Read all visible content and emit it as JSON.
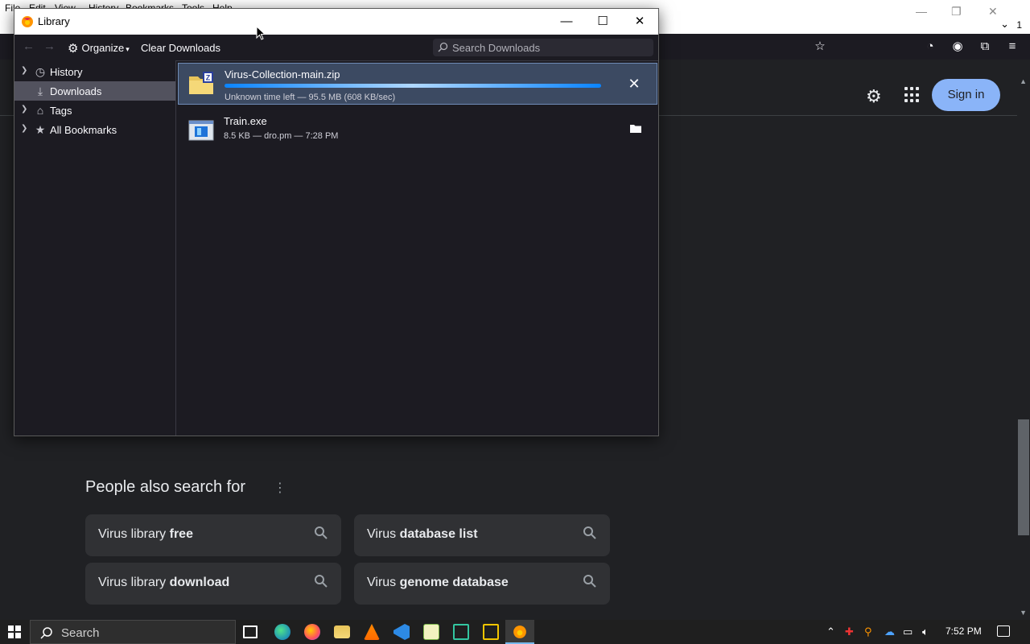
{
  "browser": {
    "menu": [
      "File",
      "Edit",
      "View",
      "History",
      "Bookmarks",
      "Tools",
      "Help"
    ],
    "tab_count": "1",
    "signin_label": "Sign in",
    "people_also_search": {
      "title": "People also search for",
      "chips": [
        {
          "prefix": "Virus library ",
          "bold": "free"
        },
        {
          "prefix": "Virus ",
          "bold": "database list"
        },
        {
          "prefix": "Virus library ",
          "bold": "download"
        },
        {
          "prefix": "Virus ",
          "bold": "genome database"
        }
      ]
    }
  },
  "library": {
    "title": "Library",
    "organize_label": "Organize",
    "clear_label": "Clear Downloads",
    "search_placeholder": "Search Downloads",
    "sidebar": [
      {
        "label": "History",
        "icon": "clock-icon",
        "expandable": true,
        "selected": false
      },
      {
        "label": "Downloads",
        "icon": "download-icon",
        "expandable": false,
        "selected": true
      },
      {
        "label": "Tags",
        "icon": "tag-icon",
        "expandable": true,
        "selected": false
      },
      {
        "label": "All Bookmarks",
        "icon": "star-icon",
        "expandable": true,
        "selected": false
      }
    ],
    "downloads": [
      {
        "name": "Virus-Collection-main.zip",
        "status": "Unknown time left — 95.5 MB (608 KB/sec)",
        "progress": 1.0,
        "in_progress": true,
        "icon": "zip-folder-icon",
        "action": "cancel"
      },
      {
        "name": "Train.exe",
        "status": "8.5 KB — dro.pm — 7:28 PM",
        "in_progress": false,
        "icon": "exe-icon",
        "action": "open-folder"
      }
    ]
  },
  "taskbar": {
    "search_placeholder": "Search",
    "clock": "7:52 PM"
  }
}
